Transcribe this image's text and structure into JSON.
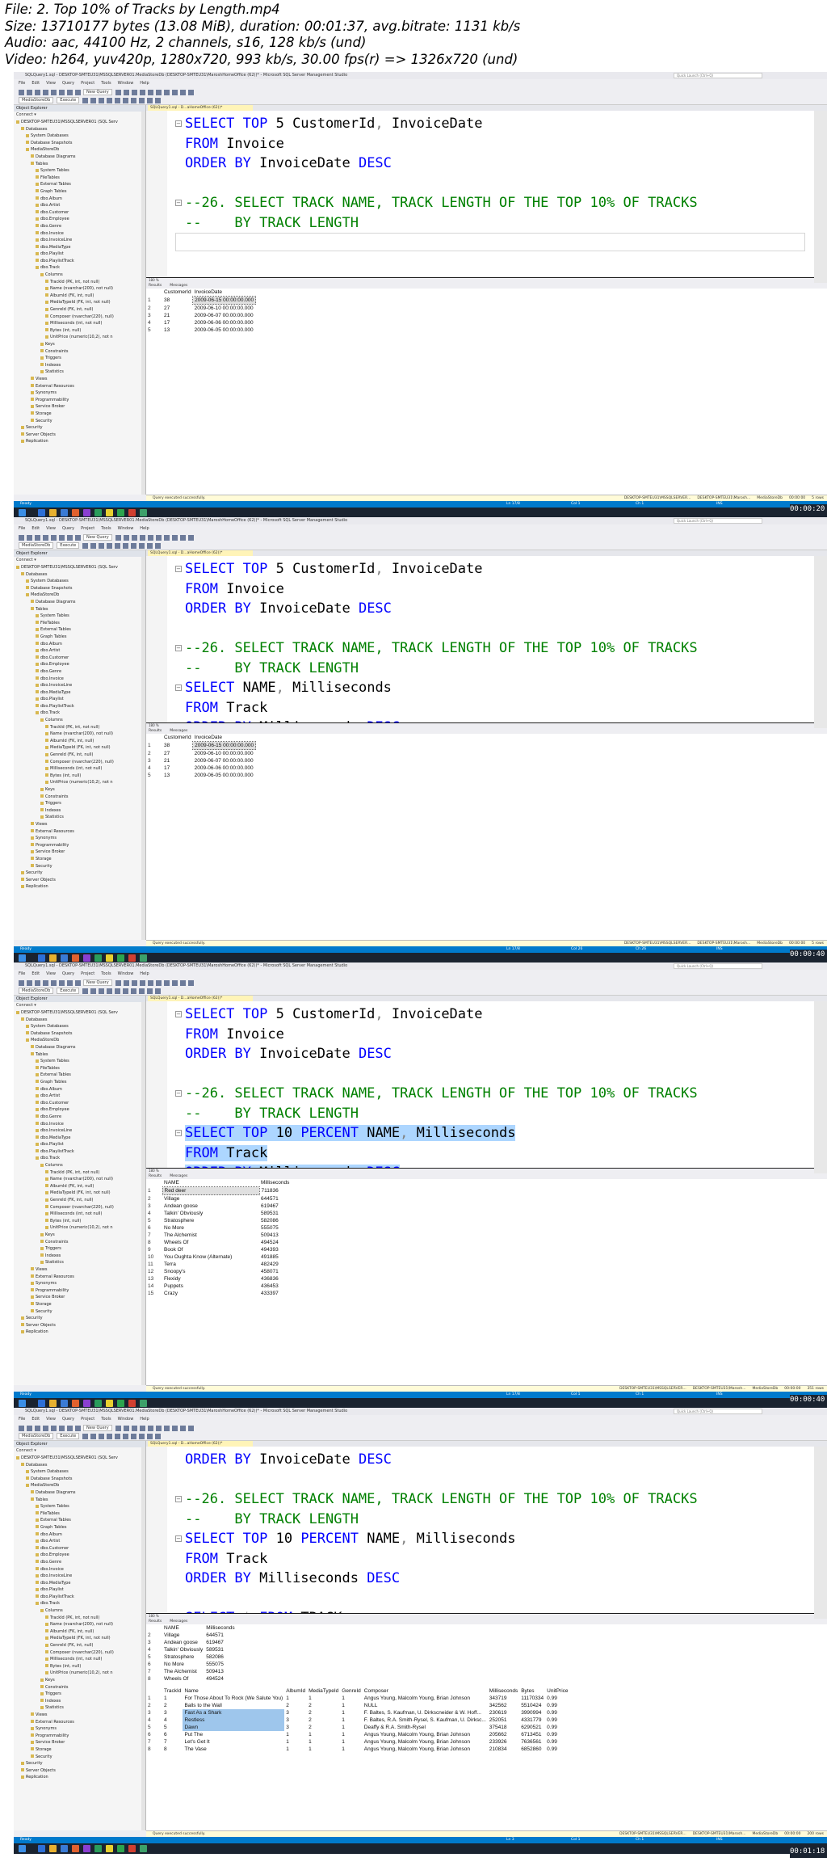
{
  "header": {
    "file": "File: 2. Top 10% of Tracks by Length.mp4",
    "size": "Size: 13710177 bytes (13.08 MiB), duration: 00:01:37, avg.bitrate: 1131 kb/s",
    "audio": "Audio: aac, 44100 Hz, 2 channels, s16, 128 kb/s (und)",
    "video": "Video: h264, yuv420p, 1280x720, 993 kb/s, 30.00 fps(r) => 1326x720 (und)"
  },
  "app": {
    "window_title": "SQLQuery1.sql - DESKTOP-SMTEU31\\MSSQLSERVER01.MediaStoreDb (DESKTOP-SMTEU31\\MaroshHomeOffice (62))* - Microsoft SQL Server Management Studio",
    "window_title_short": "SQLQuery1.sql - DESKTOP-SMTEU31\\MSSQLSERVER01.MediaStoreDb (DESKTOP-SMTEU31\\MaroshHomeOffice (62))* - Microsoft SQL Server Management Studio",
    "quick_launch": "Quick Launch (Ctrl+Q)",
    "menu": [
      "File",
      "Edit",
      "View",
      "Query",
      "Project",
      "Tools",
      "Window",
      "Help"
    ],
    "toolbar": {
      "new_query": "New Query",
      "database": "MediaStoreDb",
      "execute": "Execute"
    },
    "object_explorer": {
      "title": "Object Explorer",
      "connect": "Connect ▾",
      "tree": [
        "DESKTOP-SMTEU31\\MSSQLSERVER01 (SQL Serv",
        "Databases",
        "System Databases",
        "Database Snapshots",
        "MediaStoreDb",
        "Database Diagrams",
        "Tables",
        "System Tables",
        "FileTables",
        "External Tables",
        "Graph Tables",
        "dbo.Album",
        "dbo.Artist",
        "dbo.Customer",
        "dbo.Employee",
        "dbo.Genre",
        "dbo.Invoice",
        "dbo.InvoiceLine",
        "dbo.MediaType",
        "dbo.Playlist",
        "dbo.PlaylistTrack",
        "dbo.Track",
        "Columns",
        "TrackId (PK, int, not null)",
        "Name (nvarchar(200), not null)",
        "AlbumId (FK, int, null)",
        "MediaTypeId (FK, int, not null)",
        "GenreId (FK, int, null)",
        "Composer (nvarchar(220), null)",
        "Milliseconds (int, not null)",
        "Bytes (int, null)",
        "UnitPrice (numeric(10,2), not n",
        "Keys",
        "Constraints",
        "Triggers",
        "Indexes",
        "Statistics",
        "Views",
        "External Resources",
        "Synonyms",
        "Programmability",
        "Service Broker",
        "Storage",
        "Security",
        "Security",
        "Server Objects",
        "Replication"
      ]
    },
    "tab_label": "SQLQuery1.sql - D...aHomeOffice (62))*",
    "zoom": "180 %",
    "result_tabs": [
      "Results",
      "Messages"
    ],
    "status_ok": "Query executed successfully.",
    "status_server": "DESKTOP-SMTEU31\\MSSQLSERVER...",
    "status_user": "DESKTOP-SMTEU31\\Marosh...",
    "status_db": "MediaStoreDb",
    "status_time": "00:00:00",
    "ready": "Ready",
    "ln_label": "Ln",
    "col_label": "Col",
    "ch_label": "Ch",
    "ins": "INS"
  },
  "frames": [
    {
      "stamp": "00:00:20",
      "ln": "Ln 17/8",
      "col": "Col 1",
      "ch": "Ch 1",
      "rows_label": "5 rows",
      "code": [
        {
          "parts": [
            [
              "kw",
              "SELECT TOP "
            ],
            [
              "",
              "5 CustomerId"
            ],
            [
              "op",
              ", "
            ],
            [
              "",
              "InvoiceDate"
            ]
          ]
        },
        {
          "parts": [
            [
              "kw",
              "FROM "
            ],
            [
              "",
              "Invoice"
            ]
          ]
        },
        {
          "parts": [
            [
              "kw",
              "ORDER BY "
            ],
            [
              "",
              "InvoiceDate "
            ],
            [
              "kw",
              "DESC"
            ]
          ]
        },
        {
          "parts": []
        },
        {
          "parts": [
            [
              "cm",
              "--26. SELECT TRACK NAME, TRACK LENGTH OF THE TOP 10% OF TRACKS"
            ]
          ]
        },
        {
          "parts": [
            [
              "cm",
              "--    BY TRACK LENGTH"
            ]
          ]
        },
        {
          "parts": []
        }
      ],
      "grid_headers": [
        "CustomerId",
        "InvoiceDate"
      ],
      "grid_rows": [
        [
          "1",
          "38",
          "2009-06-15 00:00:00.000"
        ],
        [
          "2",
          "27",
          "2009-06-10 00:00:00.000"
        ],
        [
          "3",
          "21",
          "2009-06-07 00:00:00.000"
        ],
        [
          "4",
          "17",
          "2009-06-06 00:00:00.000"
        ],
        [
          "5",
          "13",
          "2009-06-05 00:00:00.000"
        ]
      ]
    },
    {
      "stamp": "00:00:40",
      "ln": "Ln 17/8",
      "col": "Col 26",
      "ch": "Ch 26",
      "rows_label": "5 rows",
      "code": [
        {
          "parts": [
            [
              "kw",
              "SELECT TOP "
            ],
            [
              "",
              "5 CustomerId"
            ],
            [
              "op",
              ", "
            ],
            [
              "",
              "InvoiceDate"
            ]
          ]
        },
        {
          "parts": [
            [
              "kw",
              "FROM "
            ],
            [
              "",
              "Invoice"
            ]
          ]
        },
        {
          "parts": [
            [
              "kw",
              "ORDER BY "
            ],
            [
              "",
              "InvoiceDate "
            ],
            [
              "kw",
              "DESC"
            ]
          ]
        },
        {
          "parts": []
        },
        {
          "parts": [
            [
              "cm",
              "--26. SELECT TRACK NAME, TRACK LENGTH OF THE TOP 10% OF TRACKS"
            ]
          ]
        },
        {
          "parts": [
            [
              "cm",
              "--    BY TRACK LENGTH"
            ]
          ]
        },
        {
          "parts": [
            [
              "kw",
              "SELECT "
            ],
            [
              "",
              "NAME"
            ],
            [
              "op",
              ", "
            ],
            [
              "",
              "Milliseconds"
            ]
          ]
        },
        {
          "parts": [
            [
              "kw",
              "FROM "
            ],
            [
              "",
              "Track"
            ]
          ]
        },
        {
          "parts": [
            [
              "kw",
              "ORDER BY "
            ],
            [
              "",
              "Milliseconds "
            ],
            [
              "kw",
              "DESC"
            ]
          ]
        }
      ],
      "grid_headers": [
        "CustomerId",
        "InvoiceDate"
      ],
      "grid_rows": [
        [
          "1",
          "38",
          "2009-06-15 00:00:00.000"
        ],
        [
          "2",
          "27",
          "2009-06-10 00:00:00.000"
        ],
        [
          "3",
          "21",
          "2009-06-07 00:00:00.000"
        ],
        [
          "4",
          "17",
          "2009-06-06 00:00:00.000"
        ],
        [
          "5",
          "13",
          "2009-06-05 00:00:00.000"
        ]
      ]
    },
    {
      "stamp": "00:00:40",
      "ln": "Ln 17/8",
      "col": "Col 1",
      "ch": "Ch 1",
      "rows_label": "351 rows",
      "code": [
        {
          "parts": [
            [
              "kw",
              "SELECT TOP "
            ],
            [
              "",
              "5 CustomerId"
            ],
            [
              "op",
              ", "
            ],
            [
              "",
              "InvoiceDate"
            ]
          ]
        },
        {
          "parts": [
            [
              "kw",
              "FROM "
            ],
            [
              "",
              "Invoice"
            ]
          ]
        },
        {
          "parts": [
            [
              "kw",
              "ORDER BY "
            ],
            [
              "",
              "InvoiceDate "
            ],
            [
              "kw",
              "DESC"
            ]
          ]
        },
        {
          "parts": []
        },
        {
          "parts": [
            [
              "cm",
              "--26. SELECT TRACK NAME, TRACK LENGTH OF THE TOP 10% OF TRACKS"
            ]
          ]
        },
        {
          "parts": [
            [
              "cm",
              "--    BY TRACK LENGTH"
            ]
          ]
        },
        {
          "sel": true,
          "parts": [
            [
              "kw",
              "SELECT TOP "
            ],
            [
              "",
              "10 "
            ],
            [
              "kw",
              "PERCENT "
            ],
            [
              "",
              "NAME"
            ],
            [
              "op",
              ", "
            ],
            [
              "",
              "Milliseconds"
            ]
          ]
        },
        {
          "sel": true,
          "parts": [
            [
              "kw",
              "FROM "
            ],
            [
              "",
              "Track"
            ]
          ]
        },
        {
          "sel": true,
          "parts": [
            [
              "kw",
              "ORDER BY "
            ],
            [
              "",
              "Milliseconds "
            ],
            [
              "kw",
              "DESC"
            ]
          ]
        }
      ],
      "grid_headers": [
        "NAME",
        "Milliseconds"
      ],
      "grid_rows": [
        [
          "1",
          "Red deer",
          "711836"
        ],
        [
          "2",
          "Village",
          "644571"
        ],
        [
          "3",
          "Andean goose",
          "619467"
        ],
        [
          "4",
          "Talkin' Obviously",
          "589531"
        ],
        [
          "5",
          "Stratosphere",
          "582086"
        ],
        [
          "6",
          "No More",
          "555075"
        ],
        [
          "7",
          "The Alchemist",
          "509413"
        ],
        [
          "8",
          "Wheels Of",
          "494524"
        ],
        [
          "9",
          "Book Of",
          "494393"
        ],
        [
          "10",
          "You Oughta Know (Alternate)",
          "491885"
        ],
        [
          "11",
          "Terra",
          "482429"
        ],
        [
          "12",
          "Snoopy's",
          "458071"
        ],
        [
          "13",
          "Flexidy",
          "436836"
        ],
        [
          "14",
          "Puppets",
          "436453"
        ],
        [
          "15",
          "Crazy",
          "433397"
        ]
      ]
    },
    {
      "stamp": "00:01:18",
      "ln": "Ln 3",
      "col": "Col 1",
      "ch": "Ch 1",
      "rows_label": "200 rows",
      "code": [
        {
          "parts": [
            [
              "kw",
              "ORDER BY "
            ],
            [
              "",
              "InvoiceDate "
            ],
            [
              "kw",
              "DESC"
            ]
          ]
        },
        {
          "parts": []
        },
        {
          "parts": [
            [
              "cm",
              "--26. SELECT TRACK NAME, TRACK LENGTH OF THE TOP 10% OF TRACKS"
            ]
          ]
        },
        {
          "parts": [
            [
              "cm",
              "--    BY TRACK LENGTH"
            ]
          ]
        },
        {
          "parts": [
            [
              "kw",
              "SELECT TOP "
            ],
            [
              "",
              "10 "
            ],
            [
              "kw",
              "PERCENT "
            ],
            [
              "",
              "NAME"
            ],
            [
              "op",
              ", "
            ],
            [
              "",
              "Milliseconds"
            ]
          ]
        },
        {
          "parts": [
            [
              "kw",
              "FROM "
            ],
            [
              "",
              "Track"
            ]
          ]
        },
        {
          "parts": [
            [
              "kw",
              "ORDER BY "
            ],
            [
              "",
              "Milliseconds "
            ],
            [
              "kw",
              "DESC"
            ]
          ]
        },
        {
          "parts": []
        },
        {
          "parts": [
            [
              "kw",
              "SELECT "
            ],
            [
              "op",
              "* "
            ],
            [
              "kw",
              "FROM "
            ],
            [
              "",
              "TRACK"
            ]
          ]
        }
      ],
      "grid_headers": [
        "NAME",
        "Milliseconds"
      ],
      "grid_rows": [
        [
          "2",
          "Village",
          "644571"
        ],
        [
          "3",
          "Andean goose",
          "619467"
        ],
        [
          "4",
          "Talkin' Obviously",
          "589531"
        ],
        [
          "5",
          "Stratosphere",
          "582086"
        ],
        [
          "6",
          "No More",
          "555075"
        ],
        [
          "7",
          "The Alchemist",
          "509413"
        ],
        [
          "8",
          "Wheels Of",
          "494524"
        ]
      ],
      "grid2_headers": [
        "TrackId",
        "Name",
        "AlbumId",
        "MediaTypeId",
        "GenreId",
        "Composer",
        "Milliseconds",
        "Bytes",
        "UnitPrice"
      ],
      "grid2_rows": [
        [
          "1",
          "1",
          "For Those About To Rock (We Salute You)",
          "1",
          "1",
          "1",
          "Angus Young, Malcolm Young, Brian Johnson",
          "343719",
          "11170334",
          "0.99"
        ],
        [
          "2",
          "2",
          "Balls to the Wall",
          "2",
          "2",
          "1",
          "NULL",
          "342562",
          "5510424",
          "0.99"
        ],
        [
          "3",
          "3",
          "Fast As a Shark",
          "3",
          "2",
          "1",
          "F. Baltes, S. Kaufman, U. Dirkscneider & W. Hoff...",
          "230619",
          "3990994",
          "0.99"
        ],
        [
          "4",
          "4",
          "Restless",
          "3",
          "2",
          "1",
          "F. Baltes, R.A. Smith-Rysel, S. Kaufman, U. Dirksc...",
          "252051",
          "4331779",
          "0.99"
        ],
        [
          "5",
          "5",
          "Dawn",
          "3",
          "2",
          "1",
          "Deaffy & R.A. Smith-Rysel",
          "375418",
          "6290521",
          "0.99"
        ],
        [
          "6",
          "6",
          "Put The",
          "1",
          "1",
          "1",
          "Angus Young, Malcolm Young, Brian Johnson",
          "205662",
          "6713451",
          "0.99"
        ],
        [
          "7",
          "7",
          "Let's Get It",
          "1",
          "1",
          "1",
          "Angus Young, Malcolm Young, Brian Johnson",
          "233926",
          "7636561",
          "0.99"
        ],
        [
          "8",
          "8",
          "The Vase",
          "1",
          "1",
          "1",
          "Angus Young, Malcolm Young, Brian Johnson",
          "210834",
          "6852860",
          "0.99"
        ]
      ]
    }
  ],
  "colors": {
    "keyword": "#0000ff",
    "comment": "#008000",
    "selection": "#add6ff",
    "statusbar": "#007acc"
  },
  "icons": [
    "folder-icon",
    "database-icon",
    "table-icon",
    "column-icon",
    "windows-start-icon"
  ]
}
